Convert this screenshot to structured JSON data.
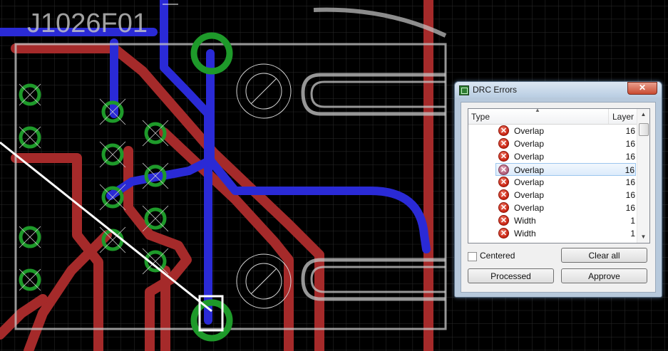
{
  "board": {
    "designator": "J1026F01",
    "colors": {
      "background": "#000000",
      "grid": "#2b2b2b",
      "top_copper": "#a52a2a",
      "bottom_copper": "#2a2ad6",
      "pad_ring": "#1e9a2a",
      "silkscreen": "#c8c8c8"
    }
  },
  "dialog": {
    "title": "DRC Errors",
    "close_label": "✕",
    "columns": {
      "type": "Type",
      "layer": "Layer"
    },
    "rows": [
      {
        "type": "Overlap",
        "layer": "16",
        "selected": false
      },
      {
        "type": "Overlap",
        "layer": "16",
        "selected": false
      },
      {
        "type": "Overlap",
        "layer": "16",
        "selected": false
      },
      {
        "type": "Overlap",
        "layer": "16",
        "selected": true
      },
      {
        "type": "Overlap",
        "layer": "16",
        "selected": false
      },
      {
        "type": "Overlap",
        "layer": "16",
        "selected": false
      },
      {
        "type": "Overlap",
        "layer": "16",
        "selected": false
      },
      {
        "type": "Width",
        "layer": "1",
        "selected": false
      },
      {
        "type": "Width",
        "layer": "1",
        "selected": false
      }
    ],
    "centered_label": "Centered",
    "centered_checked": false,
    "buttons": {
      "clear_all": "Clear all",
      "processed": "Processed",
      "approve": "Approve"
    }
  }
}
